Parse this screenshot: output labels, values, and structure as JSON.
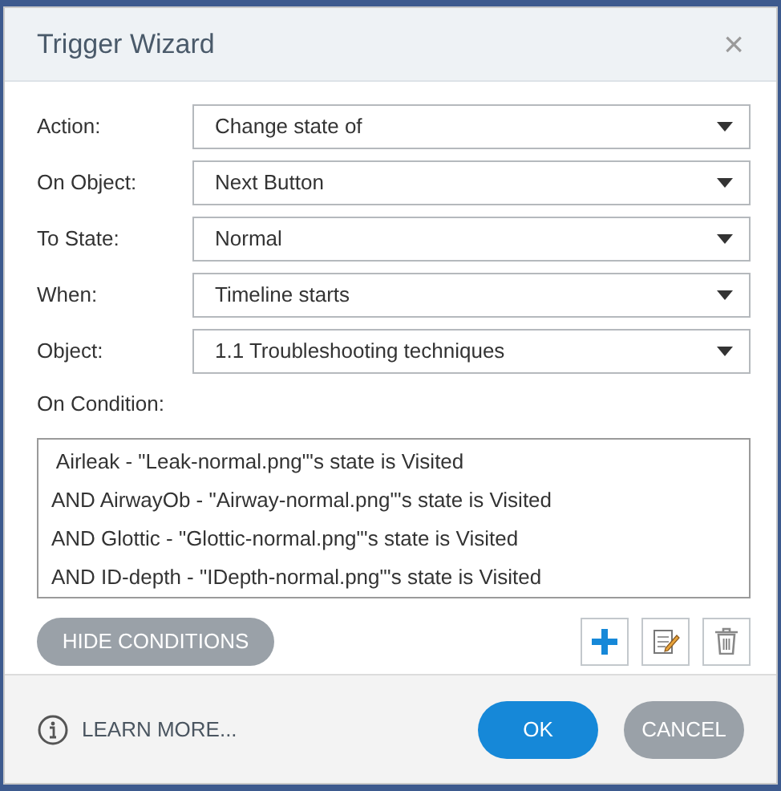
{
  "window": {
    "title": "Trigger Wizard",
    "close": "×"
  },
  "fields": [
    {
      "label": "Action:",
      "value": "Change state of"
    },
    {
      "label": "On Object:",
      "value": "Next Button"
    },
    {
      "label": "To State:",
      "value": "Normal"
    },
    {
      "label": "When:",
      "value": "Timeline starts"
    },
    {
      "label": "Object:",
      "value": "1.1 Troubleshooting techniques"
    }
  ],
  "condition_label": "On Condition:",
  "conditions": [
    " Airleak - \"Leak-normal.png\"'s state is Visited",
    "AND AirwayOb - \"Airway-normal.png\"'s state is Visited",
    "AND Glottic - \"Glottic-normal.png\"'s state is Visited",
    "AND ID-depth - \"IDepth-normal.png\"'s state is Visited"
  ],
  "hide_button": "HIDE CONDITIONS",
  "footer": {
    "learn_more": "LEARN MORE...",
    "ok": "OK",
    "cancel": "CANCEL"
  }
}
